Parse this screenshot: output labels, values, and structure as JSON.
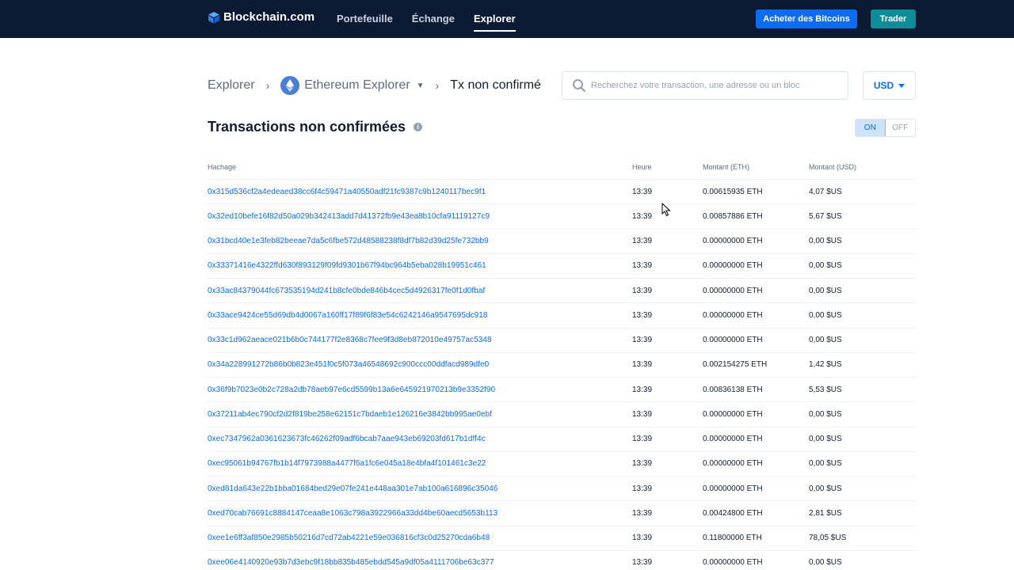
{
  "header": {
    "logo_text": "Blockchain.com",
    "nav": [
      {
        "label": "Portefeuille",
        "active": false
      },
      {
        "label": "Échange",
        "active": false
      },
      {
        "label": "Explorer",
        "active": true
      }
    ],
    "buy_button": "Acheter des Bitcoins",
    "trade_button": "Trader"
  },
  "breadcrumb": {
    "root": "Explorer",
    "explorer": "Ethereum Explorer",
    "current": "Tx non confirmé"
  },
  "search": {
    "placeholder": "Recherchez votre transaction, une adresse ou un bloc",
    "value": ""
  },
  "currency": "USD",
  "page_title": "Transactions non confirmées",
  "toggle": {
    "on_label": "ON",
    "off_label": "OFF",
    "selected": "ON"
  },
  "table": {
    "headers": {
      "hash": "Hachage",
      "time": "Heure",
      "eth": "Montant (ETH)",
      "usd": "Montant (USD)"
    },
    "rows": [
      {
        "hash": "0x315d536cf2a4edeaed38cc6f4c59471a40550adf21fc9387c9b1240117bec9f1",
        "time": "13:39",
        "eth": "0.00615935 ETH",
        "usd": "4,07 $US"
      },
      {
        "hash": "0x32ed10befe16f82d50a029b342413add7d41372fb9e43ea8b10cfa91119127c9",
        "time": "13:39",
        "eth": "0.00857886 ETH",
        "usd": "5,67 $US"
      },
      {
        "hash": "0x31bcd40e1e3feb82beeae7da5c6fbe572d48588238f8df7b82d39d25fe732bb9",
        "time": "13:39",
        "eth": "0.00000000 ETH",
        "usd": "0,00 $US"
      },
      {
        "hash": "0x33371416e4322ffd630f893129f09fd9301b67f94bc964b5eba028b19951c461",
        "time": "13:39",
        "eth": "0.00000000 ETH",
        "usd": "0,00 $US"
      },
      {
        "hash": "0x33ac84379044fc673535194d241b8cfe0bde846b4cec5d4926317fe0f1d0fbaf",
        "time": "13:39",
        "eth": "0.00000000 ETH",
        "usd": "0,00 $US"
      },
      {
        "hash": "0x33ace9424ce55d69db4d0067a160ff17f89f6f83e54c6242146a9547695dc918",
        "time": "13:39",
        "eth": "0.00000000 ETH",
        "usd": "0,00 $US"
      },
      {
        "hash": "0x33c1d962aeace021b6b0c744177f2e8368c7fee9f3d8eb872010e49757ac5348",
        "time": "13:39",
        "eth": "0.00000000 ETH",
        "usd": "0,00 $US"
      },
      {
        "hash": "0x34a228991272b86b0b823e451f0c5f073a46548692c900ccc00ddfacd989dfe0",
        "time": "13:39",
        "eth": "0.002154275 ETH",
        "usd": "1,42 $US"
      },
      {
        "hash": "0x36f9b7023e0b2c728a2db78aeb97e6cd5599b13a6e645921970213b9e3352f90",
        "time": "13:39",
        "eth": "0.00836138 ETH",
        "usd": "5,53 $US"
      },
      {
        "hash": "0x37211ab4ec790cf2d2f819be258e62151c7bdaeb1e126216e3842bb995ae0ebf",
        "time": "13:39",
        "eth": "0.00000000 ETH",
        "usd": "0,00 $US"
      },
      {
        "hash": "0xec7347962a0361623673fc46262f09adf6bcab7aae943eb69203fd617b1dff4c",
        "time": "13:39",
        "eth": "0.00000000 ETH",
        "usd": "0,00 $US"
      },
      {
        "hash": "0xec95061b94767fb1b14f7973988a4477f6a1fc6e045a18e4bfa4f101461c3e22",
        "time": "13:39",
        "eth": "0.00000000 ETH",
        "usd": "0,00 $US"
      },
      {
        "hash": "0xed81da643e22b1bba01684bed29e07fe241e448aa301e7ab100a616896c35046",
        "time": "13:39",
        "eth": "0.00000000 ETH",
        "usd": "0,00 $US"
      },
      {
        "hash": "0xed70cab76691c8884147ceaa8e1063c798a3922966a33dd4be60aecd5653b113",
        "time": "13:39",
        "eth": "0.00424800 ETH",
        "usd": "2,81 $US"
      },
      {
        "hash": "0xee1e6ff3af850e2985b50216d7cd72ab4221e59e036816cf3c0d25270cda6b48",
        "time": "13:39",
        "eth": "0.11800000 ETH",
        "usd": "78,05 $US"
      },
      {
        "hash": "0xee06e4140920e93b7d3ebc9f18bb835b485ebdd545a9df05a4111706be63c377",
        "time": "13:39",
        "eth": "0.00000000 ETH",
        "usd": "0,00 $US"
      }
    ]
  },
  "colors": {
    "header_bg": "#0c1a33",
    "accent": "#0c6cf2",
    "trade": "#0e8c98"
  }
}
